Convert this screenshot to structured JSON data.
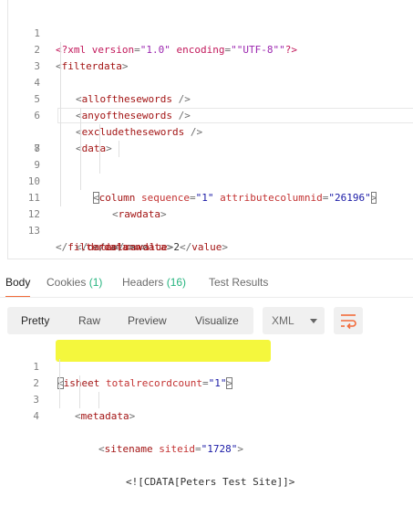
{
  "request_body": {
    "lines": [
      {
        "n": "1"
      },
      {
        "n": "2"
      },
      {
        "n": "3"
      },
      {
        "n": "4"
      },
      {
        "n": "5"
      },
      {
        "n": "6"
      },
      {
        "n": "7"
      },
      {
        "n": "8"
      },
      {
        "n": "9"
      },
      {
        "n": "10"
      },
      {
        "n": "11"
      },
      {
        "n": "12"
      },
      {
        "n": "13"
      }
    ],
    "xml_decl": {
      "target": "xml",
      "k1": "version",
      "v1": "\"1.0\"",
      "k2": "encoding",
      "v2": "\"UTF-8\""
    },
    "tags": {
      "filterdata": "filterdata",
      "allofthesewords": "allofthesewords",
      "anyofthesewords": "anyofthesewords",
      "excludethesewords": "excludethesewords",
      "data": "data",
      "column": "column",
      "attr_sequence": "sequence",
      "val_sequence": "\"1\"",
      "attr_attributecolumnid": "attributecolumnid",
      "val_attributecolumnid": "\"26196\"",
      "rawdata": "rawdata",
      "value": "value",
      "value_text": "2"
    }
  },
  "response_tabs": [
    {
      "label": "Body",
      "count": ""
    },
    {
      "label": "Cookies",
      "count": "(1)"
    },
    {
      "label": "Headers",
      "count": "(16)"
    },
    {
      "label": "Test Results",
      "count": ""
    }
  ],
  "toolbar": {
    "view_modes": [
      "Pretty",
      "Raw",
      "Preview",
      "Visualize"
    ],
    "format": "XML",
    "wrap_icon": "wrap-lines-icon"
  },
  "response_body": {
    "lines": [
      {
        "n": "1"
      },
      {
        "n": "2"
      },
      {
        "n": "3"
      },
      {
        "n": "4"
      }
    ],
    "tags": {
      "isheet": "isheet",
      "attr_totalrecordcount": "totalrecordcount",
      "val_totalrecordcount": "\"1\"",
      "metadata": "metadata",
      "sitename": "sitename",
      "attr_siteid": "siteid",
      "val_siteid": "\"1728\"",
      "cdata": "<![CDATA[Peters Test Site]]>"
    },
    "highlight_color": "#f4f73d"
  },
  "colors": {
    "accent_tab_underline": "#f26b3a",
    "count_green": "#26b47f",
    "tag": "#a31515",
    "attr": "#c33232",
    "value": "#1a1aa6"
  }
}
